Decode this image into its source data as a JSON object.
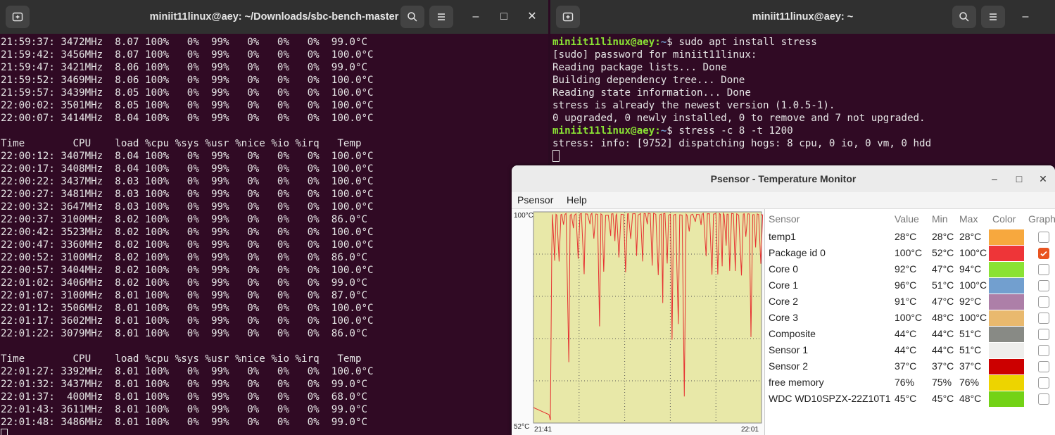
{
  "left_terminal": {
    "title": "miniit11linux@aey: ~/Downloads/sbc-bench-master",
    "lines": [
      "21:59:37: 3472MHz  8.07 100%   0%  99%   0%   0%   0%  99.0°C",
      "21:59:42: 3456MHz  8.07 100%   0%  99%   0%   0%   0%  100.0°C",
      "21:59:47: 3421MHz  8.06 100%   0%  99%   0%   0%   0%  99.0°C",
      "21:59:52: 3469MHz  8.06 100%   0%  99%   0%   0%   0%  100.0°C",
      "21:59:57: 3439MHz  8.05 100%   0%  99%   0%   0%   0%  100.0°C",
      "22:00:02: 3501MHz  8.05 100%   0%  99%   0%   0%   0%  100.0°C",
      "22:00:07: 3414MHz  8.04 100%   0%  99%   0%   0%   0%  100.0°C",
      "",
      "Time        CPU    load %cpu %sys %usr %nice %io %irq   Temp",
      "22:00:12: 3407MHz  8.04 100%   0%  99%   0%   0%   0%  100.0°C",
      "22:00:17: 3408MHz  8.04 100%   0%  99%   0%   0%   0%  100.0°C",
      "22:00:22: 3437MHz  8.03 100%   0%  99%   0%   0%   0%  100.0°C",
      "22:00:27: 3481MHz  8.03 100%   0%  99%   0%   0%   0%  100.0°C",
      "22:00:32: 3647MHz  8.03 100%   0%  99%   0%   0%   0%  100.0°C",
      "22:00:37: 3100MHz  8.02 100%   0%  99%   0%   0%   0%  86.0°C",
      "22:00:42: 3523MHz  8.02 100%   0%  99%   0%   0%   0%  100.0°C",
      "22:00:47: 3360MHz  8.02 100%   0%  99%   0%   0%   0%  100.0°C",
      "22:00:52: 3100MHz  8.02 100%   0%  99%   0%   0%   0%  86.0°C",
      "22:00:57: 3404MHz  8.02 100%   0%  99%   0%   0%   0%  100.0°C",
      "22:01:02: 3406MHz  8.02 100%   0%  99%   0%   0%   0%  99.0°C",
      "22:01:07: 3100MHz  8.01 100%   0%  99%   0%   0%   0%  87.0°C",
      "22:01:12: 3506MHz  8.01 100%   0%  99%   0%   0%   0%  100.0°C",
      "22:01:17: 3602MHz  8.01 100%   0%  99%   0%   0%   0%  100.0°C",
      "22:01:22: 3079MHz  8.01 100%   0%  99%   0%   0%   0%  86.0°C",
      "",
      "Time        CPU    load %cpu %sys %usr %nice %io %irq   Temp",
      "22:01:27: 3392MHz  8.01 100%   0%  99%   0%   0%   0%  100.0°C",
      "22:01:32: 3437MHz  8.01 100%   0%  99%   0%   0%   0%  99.0°C",
      "22:01:37:  400MHz  8.01 100%   0%  99%   0%   0%   0%  68.0°C",
      "22:01:43: 3611MHz  8.01 100%   0%  99%   0%   0%   0%  99.0°C",
      "22:01:48: 3486MHz  8.01 100%   0%  99%   0%   0%   0%  99.0°C"
    ]
  },
  "right_terminal": {
    "title": "miniit11linux@aey: ~",
    "prompt": "miniit11linux@aey:",
    "path": "~",
    "lines": [
      {
        "prompt": true,
        "text": "$ sudo apt install stress"
      },
      {
        "prompt": false,
        "text": "[sudo] password for miniit11linux:"
      },
      {
        "prompt": false,
        "text": "Reading package lists... Done"
      },
      {
        "prompt": false,
        "text": "Building dependency tree... Done"
      },
      {
        "prompt": false,
        "text": "Reading state information... Done"
      },
      {
        "prompt": false,
        "text": "stress is already the newest version (1.0.5-1)."
      },
      {
        "prompt": false,
        "text": "0 upgraded, 0 newly installed, 0 to remove and 7 not upgraded."
      },
      {
        "prompt": true,
        "text": "$ stress -c 8 -t 1200"
      },
      {
        "prompt": false,
        "text": "stress: info: [9752] dispatching hogs: 8 cpu, 0 io, 0 vm, 0 hdd"
      }
    ]
  },
  "psensor": {
    "title": "Psensor - Temperature Monitor",
    "menu": [
      "Psensor",
      "Help"
    ],
    "graph": {
      "y_max_label": "100°C",
      "y_min_label": "52°C",
      "x_start_label": "21:41",
      "x_end_label": "22:01",
      "background": "#e8e8a8",
      "line_color": "#e63232"
    },
    "columns": [
      "Sensor",
      "Value",
      "Min",
      "Max",
      "Color",
      "Graph"
    ],
    "sensors": [
      {
        "name": "temp1",
        "value": "28°C",
        "min": "28°C",
        "max": "28°C",
        "color": "#f7a83e",
        "graph": false
      },
      {
        "name": "Package id 0",
        "value": "100°C",
        "min": "52°C",
        "max": "100°C",
        "color": "#ee3538",
        "graph": true
      },
      {
        "name": "Core 0",
        "value": "92°C",
        "min": "47°C",
        "max": "94°C",
        "color": "#8ae234",
        "graph": false
      },
      {
        "name": "Core 1",
        "value": "96°C",
        "min": "51°C",
        "max": "100°C",
        "color": "#729fcf",
        "graph": false
      },
      {
        "name": "Core 2",
        "value": "91°C",
        "min": "47°C",
        "max": "92°C",
        "color": "#ad7fa8",
        "graph": false
      },
      {
        "name": "Core 3",
        "value": "100°C",
        "min": "48°C",
        "max": "100°C",
        "color": "#e9b96e",
        "graph": false
      },
      {
        "name": "Composite",
        "value": "44°C",
        "min": "44°C",
        "max": "51°C",
        "color": "#888a85",
        "graph": false
      },
      {
        "name": "Sensor 1",
        "value": "44°C",
        "min": "44°C",
        "max": "51°C",
        "color": "#eeeeec",
        "graph": false
      },
      {
        "name": "Sensor 2",
        "value": "37°C",
        "min": "37°C",
        "max": "37°C",
        "color": "#cc0000",
        "graph": false
      },
      {
        "name": "free memory",
        "value": "76%",
        "min": "75%",
        "max": "76%",
        "color": "#edd400",
        "graph": false
      },
      {
        "name": "WDC WD10SPZX-22Z10T1",
        "value": "45°C",
        "min": "45°C",
        "max": "48°C",
        "color": "#73d216",
        "graph": false
      }
    ]
  }
}
